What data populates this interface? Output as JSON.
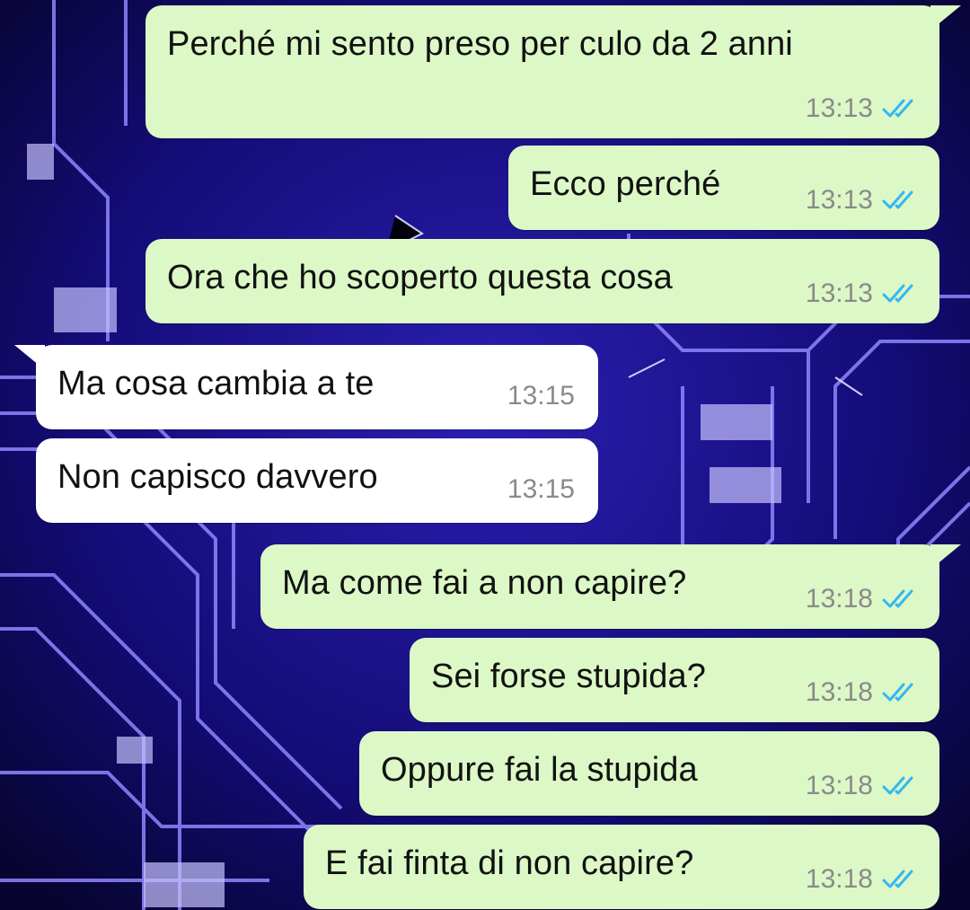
{
  "chat": {
    "messages": [
      {
        "direction": "out",
        "text": "Perché mi sento preso per culo da 2 anni",
        "time": "13:13",
        "status_icon": "double-check-read-icon"
      },
      {
        "direction": "out",
        "text": "Ecco perché",
        "time": "13:13",
        "status_icon": "double-check-read-icon"
      },
      {
        "direction": "out",
        "text": "Ora che ho scoperto questa cosa",
        "time": "13:13",
        "status_icon": "double-check-read-icon"
      },
      {
        "direction": "in",
        "text": "Ma cosa cambia a te",
        "time": "13:15"
      },
      {
        "direction": "in",
        "text": "Non capisco davvero",
        "time": "13:15"
      },
      {
        "direction": "out",
        "text": "Ma come fai a non capire?",
        "time": "13:18",
        "status_icon": "double-check-read-icon"
      },
      {
        "direction": "out",
        "text": "Sei forse stupida?",
        "time": "13:18",
        "status_icon": "double-check-read-icon"
      },
      {
        "direction": "out",
        "text": "Oppure fai la stupida",
        "time": "13:18",
        "status_icon": "double-check-read-icon"
      },
      {
        "direction": "out",
        "text": "E fai finta di non capire?",
        "time": "13:18",
        "status_icon": "double-check-read-icon"
      }
    ]
  },
  "colors": {
    "outgoing_bubble": "#dcf8c6",
    "incoming_bubble": "#ffffff",
    "read_ticks": "#34b7f1",
    "wallpaper_base": "#0a0740",
    "circuit_glow": "#7a6bff"
  }
}
